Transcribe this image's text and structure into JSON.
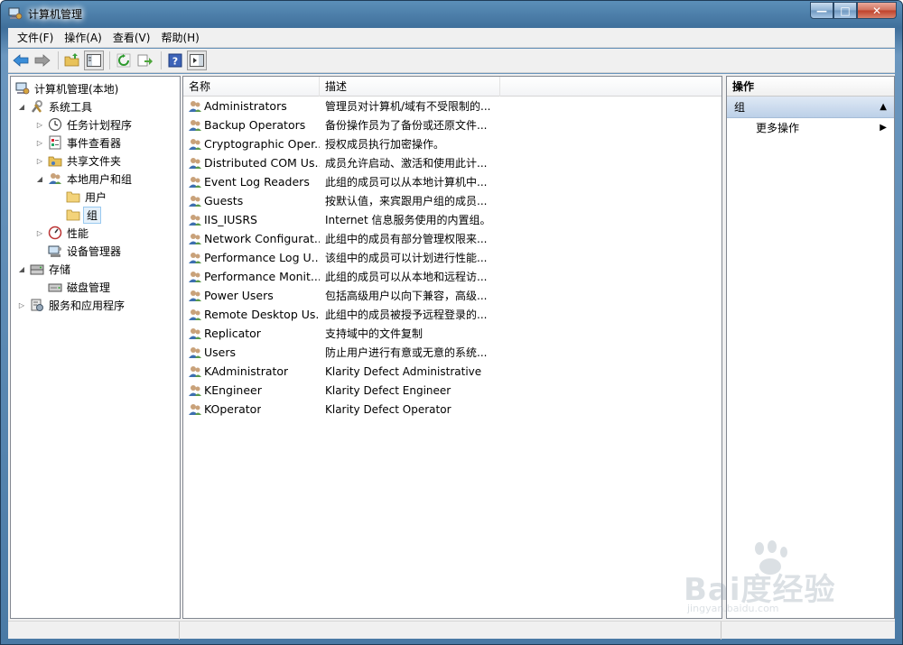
{
  "window": {
    "title": "计算机管理",
    "controls": {
      "minimize": "—",
      "maximize": "□",
      "close": "✕"
    }
  },
  "menubar": {
    "items": [
      "文件(F)",
      "操作(A)",
      "查看(V)",
      "帮助(H)"
    ]
  },
  "tree": {
    "root": "计算机管理(本地)",
    "items": [
      {
        "label": "系统工具",
        "icon": "tools-icon",
        "toggle": "◢"
      },
      {
        "label": "任务计划程序",
        "icon": "clock-icon",
        "toggle": "▷"
      },
      {
        "label": "事件查看器",
        "icon": "event-viewer-icon",
        "toggle": "▷"
      },
      {
        "label": "共享文件夹",
        "icon": "shared-folder-icon",
        "toggle": "▷"
      },
      {
        "label": "本地用户和组",
        "icon": "users-icon",
        "toggle": "◢"
      },
      {
        "label": "用户",
        "icon": "folder-icon",
        "toggle": ""
      },
      {
        "label": "组",
        "icon": "folder-icon",
        "toggle": ""
      },
      {
        "label": "性能",
        "icon": "performance-icon",
        "toggle": "▷"
      },
      {
        "label": "设备管理器",
        "icon": "device-manager-icon",
        "toggle": ""
      },
      {
        "label": "存储",
        "icon": "storage-icon",
        "toggle": "◢"
      },
      {
        "label": "磁盘管理",
        "icon": "disk-icon",
        "toggle": ""
      },
      {
        "label": "服务和应用程序",
        "icon": "services-icon",
        "toggle": "▷"
      }
    ]
  },
  "list": {
    "columns": {
      "name": "名称",
      "description": "描述"
    },
    "rows": [
      {
        "name": "Administrators",
        "description": "管理员对计算机/域有不受限制的..."
      },
      {
        "name": "Backup Operators",
        "description": "备份操作员为了备份或还原文件..."
      },
      {
        "name": "Cryptographic Oper...",
        "description": "授权成员执行加密操作。"
      },
      {
        "name": "Distributed COM Us...",
        "description": "成员允许启动、激活和使用此计..."
      },
      {
        "name": "Event Log Readers",
        "description": "此组的成员可以从本地计算机中..."
      },
      {
        "name": "Guests",
        "description": "按默认值，来宾跟用户组的成员..."
      },
      {
        "name": "IIS_IUSRS",
        "description": "Internet 信息服务使用的内置组。"
      },
      {
        "name": "Network Configurat...",
        "description": "此组中的成员有部分管理权限来..."
      },
      {
        "name": "Performance Log U...",
        "description": "该组中的成员可以计划进行性能..."
      },
      {
        "name": "Performance Monit...",
        "description": "此组的成员可以从本地和远程访..."
      },
      {
        "name": "Power Users",
        "description": "包括高级用户以向下兼容，高级..."
      },
      {
        "name": "Remote Desktop Us...",
        "description": "此组中的成员被授予远程登录的..."
      },
      {
        "name": "Replicator",
        "description": "支持域中的文件复制"
      },
      {
        "name": "Users",
        "description": "防止用户进行有意或无意的系统..."
      },
      {
        "name": "KAdministrator",
        "description": "Klarity Defect Administrative"
      },
      {
        "name": "KEngineer",
        "description": "Klarity Defect Engineer"
      },
      {
        "name": "KOperator",
        "description": "Klarity Defect Operator"
      }
    ]
  },
  "actions": {
    "title": "操作",
    "group": "组",
    "group_arrow": "▲",
    "more": "更多操作",
    "more_arrow": "▶"
  },
  "watermark": {
    "text": "Bai度经验",
    "sub": "jingyan.baidu.com"
  }
}
